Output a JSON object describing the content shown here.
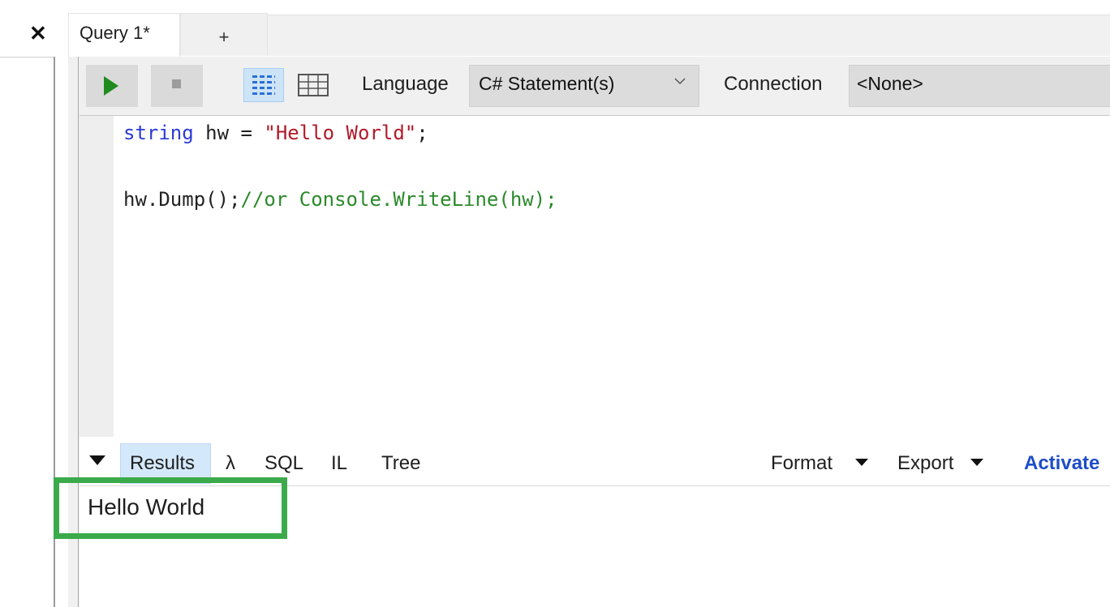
{
  "window": {
    "close_glyph": "✕"
  },
  "tabs": {
    "active_label": "Query 1*",
    "add_label": "+"
  },
  "toolbar": {
    "run_icon": "play-icon",
    "stop_icon": "stop-icon",
    "rows_view_icon": "rows-view-icon",
    "grid_view_icon": "grid-view-icon",
    "language_label": "Language",
    "language_value": "C# Statement(s)",
    "connection_label": "Connection",
    "connection_value": "<None>"
  },
  "editor": {
    "line1": {
      "keyword": "string",
      "plain": " hw = ",
      "string": "\"Hello World\"",
      "end": ";"
    },
    "line2": {
      "plain": "hw.Dump();",
      "comment": "//or Console.WriteLine(hw);"
    }
  },
  "results": {
    "tabs": [
      "Results",
      "λ",
      "SQL",
      "IL",
      "Tree"
    ],
    "format_label": "Format",
    "export_label": "Export",
    "activate_label": "Activate",
    "output": "Hello World"
  },
  "colors": {
    "run_green": "#1f8b1f",
    "keyword_blue": "#2b3bd4",
    "string_red": "#b11a2a",
    "comment_green": "#2b8a2b",
    "highlight_green": "#3aaa4a",
    "activate_blue": "#1e4dc8"
  }
}
